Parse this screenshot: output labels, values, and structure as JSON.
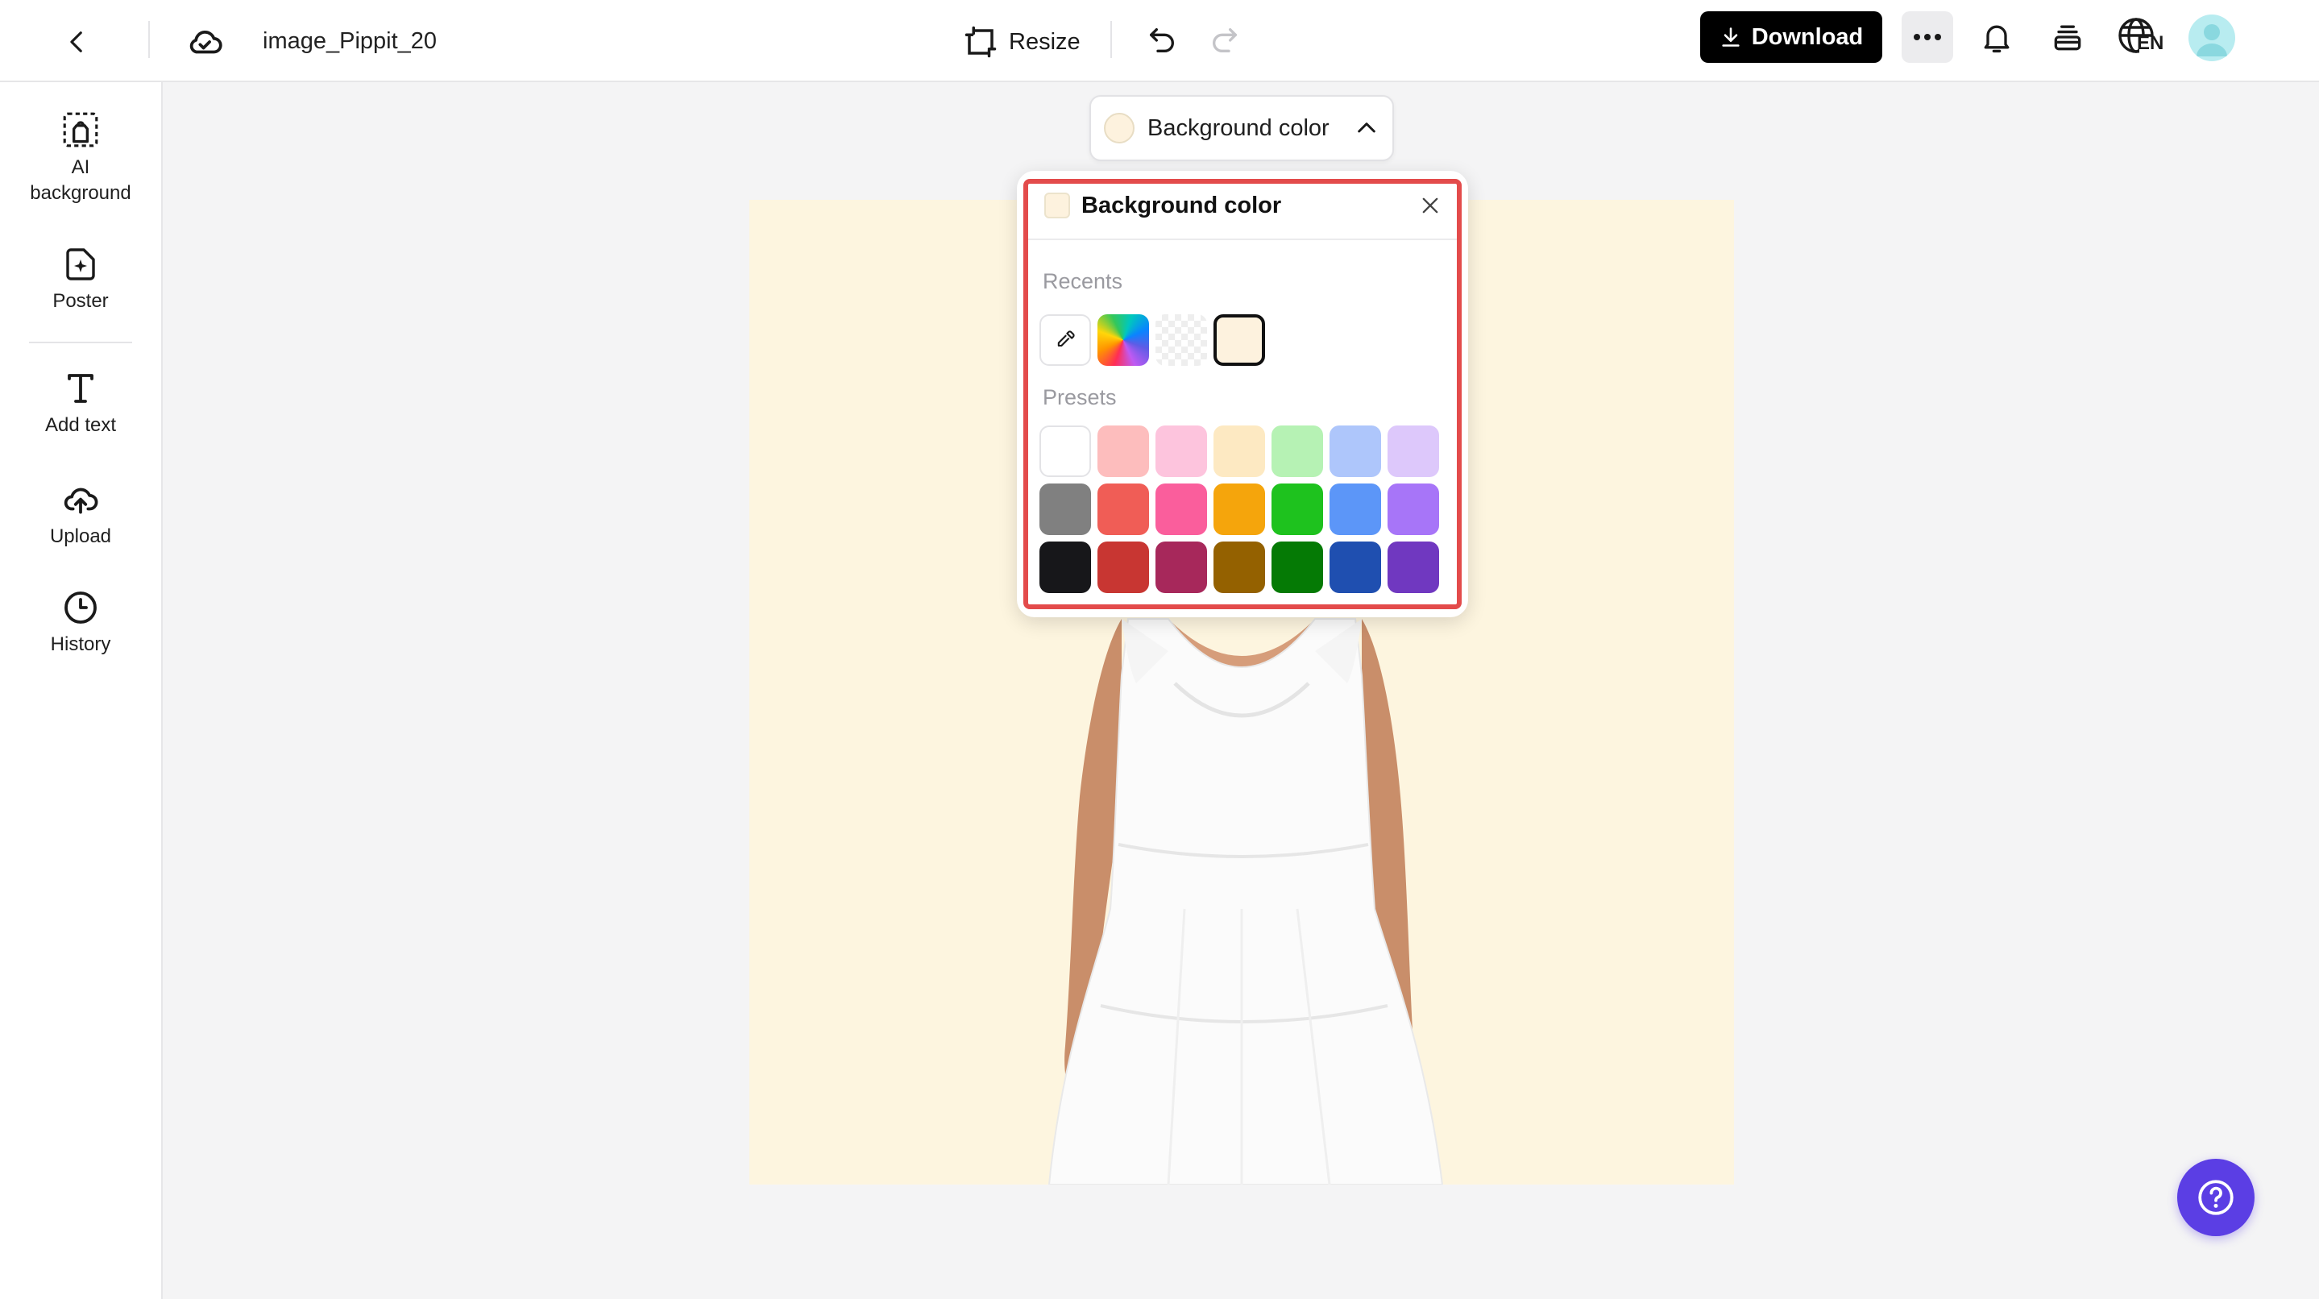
{
  "header": {
    "back_icon": "chevron-left-icon",
    "cloud_icon": "cloud-sync-icon",
    "filename": "image_Pippit_20",
    "resize_label": "Resize",
    "undo_icon": "undo-icon",
    "redo_icon": "redo-icon",
    "download_label": "Download",
    "more_icon": "more-horizontal-icon",
    "bell_icon": "bell-icon",
    "layers_icon": "layers-icon",
    "language_code": "EN",
    "avatar_icon": "user-avatar-icon"
  },
  "sidebar": {
    "items": [
      {
        "label": "AI\nbackground",
        "icon": "ai-background-icon"
      },
      {
        "label": "Poster",
        "icon": "poster-icon"
      },
      {
        "label": "Add text",
        "icon": "text-icon"
      },
      {
        "label": "Upload",
        "icon": "upload-cloud-icon"
      },
      {
        "label": "History",
        "icon": "clock-icon"
      }
    ]
  },
  "canvas": {
    "background_color": "#FDF5DF"
  },
  "bg_toggle": {
    "label": "Background color",
    "current_color": "#FDF2DE"
  },
  "color_panel": {
    "title": "Background color",
    "recents_label": "Recents",
    "presets_label": "Presets",
    "recents": [
      "eyedropper",
      "custom-gradient",
      "transparent",
      "#FDF2DE"
    ],
    "selected": "#FDF2DE",
    "presets": [
      [
        "#FFFFFF",
        "#FDBDBD",
        "#FDC4DD",
        "#FDE9C2",
        "#B6F2B4",
        "#AEC6FB",
        "#DDC8FB"
      ],
      [
        "#808080",
        "#F05D56",
        "#FA5E9C",
        "#F5A50C",
        "#1EC21E",
        "#5C96F8",
        "#A775F8"
      ],
      [
        "#17171A",
        "#C83632",
        "#A7285B",
        "#946100",
        "#057A05",
        "#1F4FB0",
        "#7038C0"
      ]
    ]
  },
  "colors": {
    "accent_help": "#5B3EE4",
    "highlight_outline": "#E34B4B"
  },
  "help_icon": "question-circle-icon"
}
